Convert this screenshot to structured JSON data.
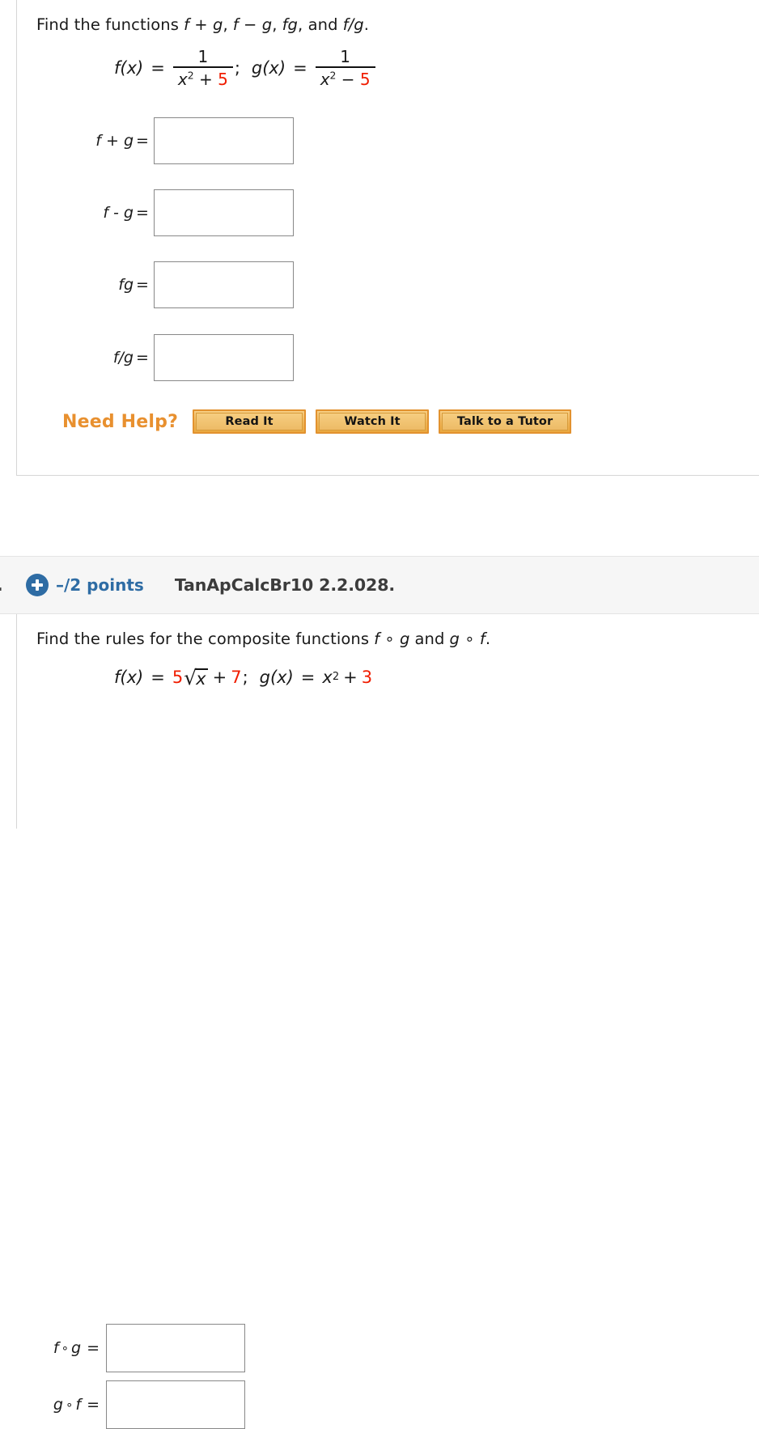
{
  "problem1": {
    "prompt": {
      "lead": "Find the functions",
      "f_plus_g": "f + g",
      "comma1": ",",
      "f_minus_g": "f − g",
      "comma2": ",",
      "fg": "fg",
      "conjunction": ", and",
      "f_over_g": "f/g",
      "period": "."
    },
    "definitions": {
      "f_name": "f(x)",
      "f_equals": "=",
      "f_numerator": "1",
      "f_den_var": "x",
      "f_den_power": "2",
      "f_den_operator": "+",
      "f_den_constant": "5",
      "separator": ";",
      "g_name": "g(x)",
      "g_equals": "=",
      "g_numerator": "1",
      "g_den_var": "x",
      "g_den_power": "2",
      "g_den_operator": "−",
      "g_den_constant": "5"
    },
    "answers": [
      {
        "label": "f + g",
        "equals": "=",
        "value": "",
        "placeholder": ""
      },
      {
        "label": "f - g",
        "equals": "=",
        "value": "",
        "placeholder": ""
      },
      {
        "label": "fg",
        "equals": "=",
        "value": "",
        "placeholder": ""
      },
      {
        "label": "f/g",
        "equals": "=",
        "value": "",
        "placeholder": ""
      }
    ],
    "need_help": {
      "label": "Need Help?",
      "buttons": [
        {
          "label": "Read It"
        },
        {
          "label": "Watch It"
        },
        {
          "label": "Talk to a Tutor"
        }
      ]
    }
  },
  "problem2": {
    "header": {
      "number": ".",
      "icon": "plus-circle-icon",
      "points": "–/2 points",
      "assignment_id": "TanApCalcBr10 2.2.028."
    },
    "prompt": {
      "lead": "Find the rules for the composite functions",
      "f_of_g": "f ∘ g",
      "and": "and",
      "g_of_f": "g ∘ f",
      "period": "."
    },
    "definitions": {
      "f_name": "f(x)",
      "f_equals": "=",
      "f_coefficient": "5",
      "f_radical": "√",
      "f_radicand": "x",
      "f_plus": "+",
      "f_constant": "7",
      "separator": ";",
      "g_name": "g(x)",
      "g_equals": "=",
      "g_var": "x",
      "g_power": "2",
      "g_plus": "+",
      "g_constant": "3"
    },
    "answers": [
      {
        "label_left": "f",
        "circ": "∘",
        "label_right": "g",
        "equals": "=",
        "value": "",
        "placeholder": ""
      },
      {
        "label_left": "g",
        "circ": "∘",
        "label_right": "f",
        "equals": "=",
        "value": "",
        "placeholder": ""
      }
    ]
  },
  "colors": {
    "highlight_red": "#f01d00",
    "accent_orange": "#e8902f",
    "accent_blue": "#2e6ca4",
    "text_dark": "#1a1a1a",
    "header_band": "#f6f6f6",
    "border_gray": "#d6d6d6"
  }
}
